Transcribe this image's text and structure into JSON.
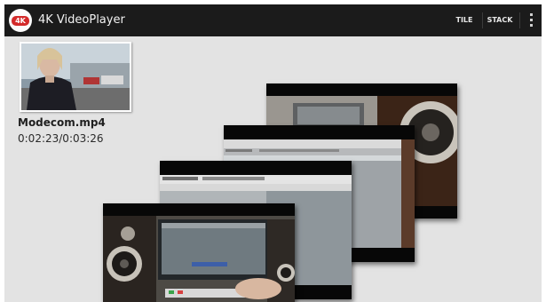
{
  "app": {
    "logo_text": "4K",
    "title": "4K VideoPlayer"
  },
  "actionbar": {
    "tile_label": "TILE",
    "stack_label": "STACK",
    "overflow_icon": "overflow-menu-icon"
  },
  "video": {
    "file_name": "Modecom.mp4",
    "time": "0:02:23/0:03:26"
  },
  "colors": {
    "actionbar": "#1b1b1b",
    "background": "#e3e3e3",
    "logo_badge": "#d32a2a"
  }
}
